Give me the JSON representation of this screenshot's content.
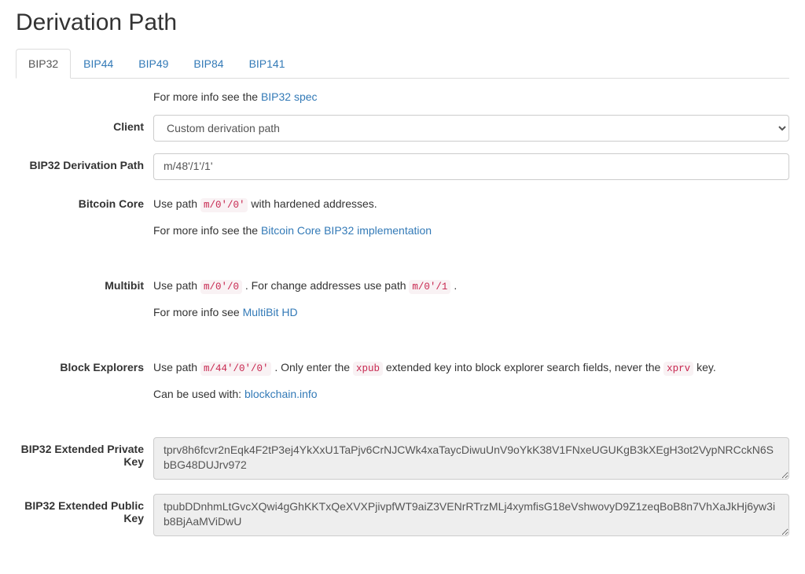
{
  "title": "Derivation Path",
  "tabs": {
    "bip32": "BIP32",
    "bip44": "BIP44",
    "bip49": "BIP49",
    "bip84": "BIP84",
    "bip141": "BIP141"
  },
  "intro": {
    "prefix": "For more info see the ",
    "link": "BIP32 spec"
  },
  "labels": {
    "client": "Client",
    "derivation_path": "BIP32 Derivation Path",
    "bitcoin_core": "Bitcoin Core",
    "multibit": "Multibit",
    "block_explorers": "Block Explorers",
    "xprv": "BIP32 Extended Private Key",
    "xpub": "BIP32 Extended Public Key"
  },
  "client": {
    "selected": "Custom derivation path"
  },
  "derivation_path_value": "m/48'/1'/1'",
  "bitcoin_core": {
    "l1a": "Use path ",
    "l1code": "m/0'/0'",
    "l1b": " with hardened addresses.",
    "l2a": "For more info see the ",
    "l2link": "Bitcoin Core BIP32 implementation"
  },
  "multibit": {
    "l1a": "Use path ",
    "l1code1": "m/0'/0",
    "l1b": " . For change addresses use path ",
    "l1code2": "m/0'/1",
    "l1c": " .",
    "l2a": "For more info see ",
    "l2link": "MultiBit HD"
  },
  "block_explorers": {
    "l1a": "Use path ",
    "l1code1": "m/44'/0'/0'",
    "l1b": " . Only enter the ",
    "l1code2": "xpub",
    "l1c": " extended key into block explorer search fields, never the ",
    "l1code3": "xprv",
    "l1d": " key.",
    "l2a": "Can be used with: ",
    "l2link": "blockchain.info"
  },
  "xprv_value": "tprv8h6fcvr2nEqk4F2tP3ej4YkXxU1TaPjv6CrNJCWk4xaTaycDiwuUnV9oYkK38V1FNxeUGUKgB3kXEgH3ot2VypNRCckN6SbBG48DUJrv972",
  "xpub_value": "tpubDDnhmLtGvcXQwi4gGhKKTxQeXVXPjivpfWT9aiZ3VENrRTrzMLj4xymfisG18eVshwovyD9Z1zeqBoB8n7VhXaJkHj6yw3ib8BjAaMViDwU"
}
